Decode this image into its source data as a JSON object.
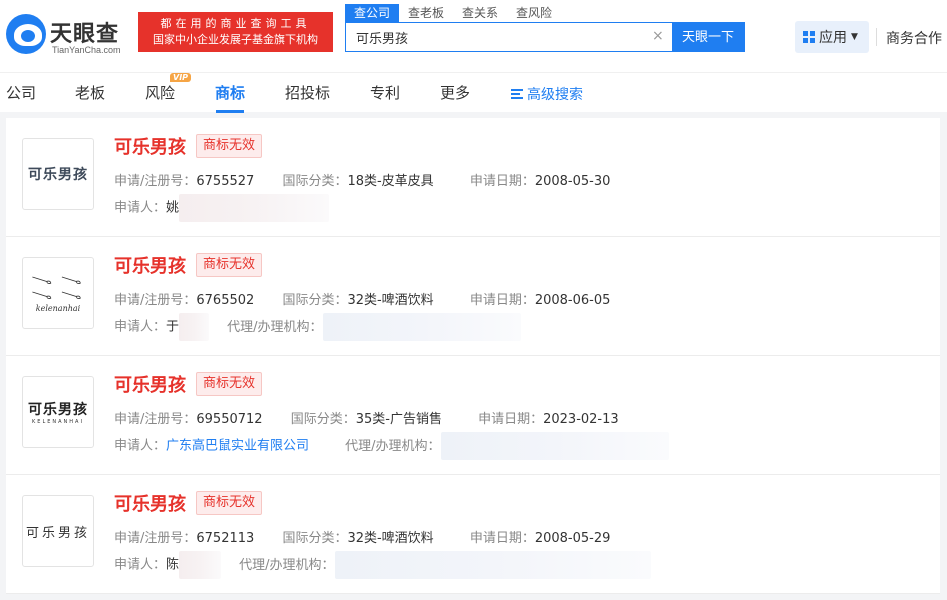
{
  "header": {
    "logo_name": "天眼查",
    "logo_domain": "TianYanCha.com",
    "slogan_line1": "都在用的商业查询工具",
    "slogan_line2": "国家中小企业发展子基金旗下机构",
    "search_tabs": [
      "查公司",
      "查老板",
      "查关系",
      "查风险"
    ],
    "search_value": "可乐男孩",
    "search_button": "天眼一下",
    "app_button": "应用",
    "business": "商务合作"
  },
  "nav": {
    "items": [
      "公司",
      "老板",
      "风险",
      "商标",
      "招投标",
      "专利",
      "更多"
    ],
    "vip_label": "VIP",
    "advanced_search": "高级搜索"
  },
  "labels": {
    "reg_no": "申请/注册号：",
    "intl_class": "国际分类：",
    "app_date": "申请日期：",
    "applicant": "申请人：",
    "agency": "代理/办理机构："
  },
  "results": [
    {
      "name": "可乐男孩",
      "status": "商标无效",
      "reg_no": "6755527",
      "class": "18类-皮革皮具",
      "date": "2008-05-30",
      "applicant": "姚",
      "thumb_text": "可乐男孩"
    },
    {
      "name": "可乐男孩",
      "status": "商标无效",
      "reg_no": "6765502",
      "class": "32类-啤酒饮料",
      "date": "2008-06-05",
      "applicant": "于",
      "thumb_text": "kelenanhai"
    },
    {
      "name": "可乐男孩",
      "status": "商标无效",
      "reg_no": "69550712",
      "class": "35类-广告销售",
      "date": "2023-02-13",
      "applicant": "广东高巴鼠实业有限公司",
      "thumb_text": "可乐男孩",
      "thumb_sub": "KELENANHAI"
    },
    {
      "name": "可乐男孩",
      "status": "商标无效",
      "reg_no": "6752113",
      "class": "32类-啤酒饮料",
      "date": "2008-05-29",
      "applicant": "陈",
      "thumb_text": "可乐男孩"
    }
  ],
  "colors": {
    "brand_blue": "#1f7ef1",
    "red": "#e6322b"
  }
}
